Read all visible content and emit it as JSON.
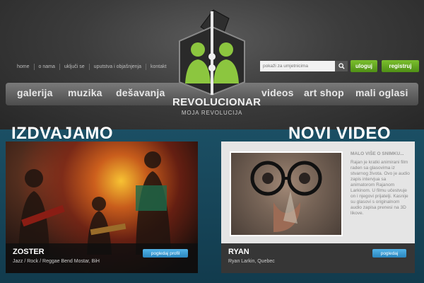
{
  "header": {
    "top_links": [
      "home",
      "o nama",
      "uključi se",
      "uputstva i objašnjenja",
      "kontakt"
    ],
    "search": {
      "placeholder": "pokaži za umjetnicima"
    },
    "buttons": {
      "login": "uloguj",
      "register": "registruj"
    }
  },
  "logo": {
    "title": "REVOLUCIONAR",
    "subtitle": "MOJA REVOLUCIJA"
  },
  "nav": {
    "items": [
      "galerija",
      "muzika",
      "dešavanja",
      "videos",
      "art shop",
      "mali oglasi"
    ]
  },
  "featured": {
    "section_title": "IZDVAJAMO",
    "title": "ZOSTER",
    "subtitle": "Jazz / Rock / Reggae Bend Mostar, BiH",
    "button": "pogledaj profil"
  },
  "video": {
    "section_title": "NOVI VIDEO",
    "sidebar_title": "MALO VIŠE O SNIMKU...",
    "description": "Rajan je kratki animirani film raden sa glasovima iz stvarnog života. Ovo je audio zapis intervjua sa animatorom Rajanom Larkinom. U filmu učestvuje on i njegovi prijatelji. Kasnije su glasovi s originalnom audio zapisa prenesi na 3D likove.",
    "title": "RYAN",
    "subtitle": "Ryan Larkin, Quebec",
    "button": "pogledaj"
  },
  "colors": {
    "accent_green": "#6db52a",
    "accent_blue": "#3a9ad6",
    "section_bg": "#1b4f64"
  }
}
